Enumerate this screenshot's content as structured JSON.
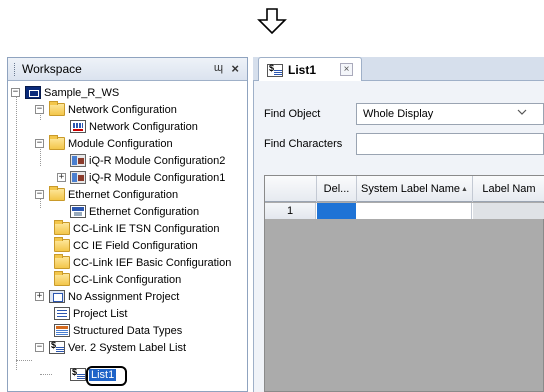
{
  "workspace": {
    "title": "Workspace",
    "pin_icon": "pin-icon",
    "close_icon": "close-icon",
    "pin_glyph": "ɰ",
    "close_glyph": "×"
  },
  "tree": {
    "root": "Sample_R_WS",
    "network_folder": "Network Configuration",
    "network_item": "Network Configuration",
    "module_folder": "Module Configuration",
    "module_item_2": "iQ-R Module Configuration2",
    "module_item_1": "iQ-R Module Configuration1",
    "ethernet_folder": "Ethernet Configuration",
    "ethernet_item": "Ethernet Configuration",
    "cc_link_ie_tsn": "CC-Link IE TSN Configuration",
    "cc_ie_field": "CC IE Field Configuration",
    "cc_link_ief_basic": "CC-Link IEF Basic Configuration",
    "cc_link": "CC-Link Configuration",
    "no_assignment": "No Assignment Project",
    "project_list": "Project List",
    "structured_types": "Structured Data Types",
    "system_label_list": "Ver. 2 System Label List",
    "list1": "List1",
    "expand_minus": "−",
    "expand_plus": "+"
  },
  "tab": {
    "label": "List1",
    "close_glyph": "×"
  },
  "find": {
    "object_label": "Find Object",
    "object_value": "Whole Display",
    "characters_label": "Find Characters",
    "characters_value": ""
  },
  "grid": {
    "columns": [
      "Del...",
      "System Label Name",
      "Label Nam"
    ],
    "rows": [
      {
        "num": "1"
      }
    ]
  },
  "colors": {
    "accent": "#1e63c8",
    "selected_cell": "#1e73d6"
  }
}
